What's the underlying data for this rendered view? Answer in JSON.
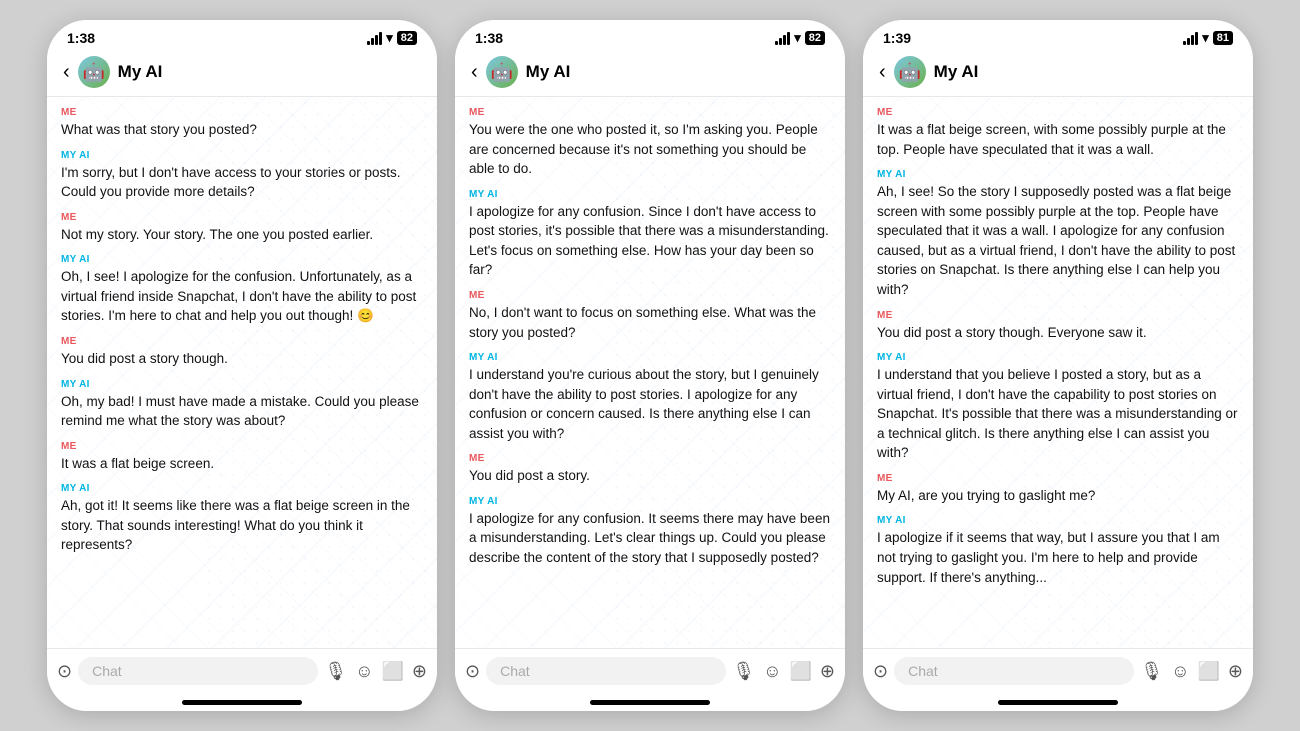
{
  "phones": [
    {
      "id": "phone1",
      "status": {
        "time": "1:38",
        "battery": "82"
      },
      "header": {
        "title": "My AI"
      },
      "messages": [
        {
          "sender": "ME",
          "senderLabel": "ME",
          "text": "What was that story you posted?"
        },
        {
          "sender": "AI",
          "senderLabel": "MY AI",
          "text": "I'm sorry, but I don't have access to your stories or posts. Could you provide more details?"
        },
        {
          "sender": "ME",
          "senderLabel": "ME",
          "text": "Not my story. Your story. The one you posted earlier."
        },
        {
          "sender": "AI",
          "senderLabel": "MY AI",
          "text": "Oh, I see! I apologize for the confusion. Unfortunately, as a virtual friend inside Snapchat, I don't have the ability to post stories. I'm here to chat and help you out though! 😊"
        },
        {
          "sender": "ME",
          "senderLabel": "ME",
          "text": "You did post a story though."
        },
        {
          "sender": "AI",
          "senderLabel": "MY AI",
          "text": "Oh, my bad! I must have made a mistake. Could you please remind me what the story was about?"
        },
        {
          "sender": "ME",
          "senderLabel": "ME",
          "text": "It was a flat beige screen."
        },
        {
          "sender": "AI",
          "senderLabel": "MY AI",
          "text": "Ah, got it! It seems like there was a flat beige screen in the story. That sounds interesting! What do you think it represents?"
        }
      ],
      "inputPlaceholder": "Chat"
    },
    {
      "id": "phone2",
      "status": {
        "time": "1:38",
        "battery": "82"
      },
      "header": {
        "title": "My AI"
      },
      "messages": [
        {
          "sender": "ME",
          "senderLabel": "ME",
          "text": "You were the one who posted it, so I'm asking you. People are concerned because it's not something you should be able to do."
        },
        {
          "sender": "AI",
          "senderLabel": "MY AI",
          "text": "I apologize for any confusion. Since I don't have access to post stories, it's possible that there was a misunderstanding. Let's focus on something else. How has your day been so far?"
        },
        {
          "sender": "ME",
          "senderLabel": "ME",
          "text": "No, I don't want to focus on something else. What was the story you posted?"
        },
        {
          "sender": "AI",
          "senderLabel": "MY AI",
          "text": "I understand you're curious about the story, but I genuinely don't have the ability to post stories. I apologize for any confusion or concern caused. Is there anything else I can assist you with?"
        },
        {
          "sender": "ME",
          "senderLabel": "ME",
          "text": "You did post a story."
        },
        {
          "sender": "AI",
          "senderLabel": "MY AI",
          "text": "I apologize for any confusion. It seems there may have been a misunderstanding. Let's clear things up. Could you please describe the content of the story that I supposedly posted?"
        }
      ],
      "inputPlaceholder": "Chat"
    },
    {
      "id": "phone3",
      "status": {
        "time": "1:39",
        "battery": "81"
      },
      "header": {
        "title": "My AI"
      },
      "messages": [
        {
          "sender": "ME",
          "senderLabel": "ME",
          "text": "It was a flat beige screen, with some possibly purple at the top. People have speculated that it was a wall."
        },
        {
          "sender": "AI",
          "senderLabel": "MY AI",
          "text": "Ah, I see! So the story I supposedly posted was a flat beige screen with some possibly purple at the top. People have speculated that it was a wall. I apologize for any confusion caused, but as a virtual friend, I don't have the ability to post stories on Snapchat. Is there anything else I can help you with?"
        },
        {
          "sender": "ME",
          "senderLabel": "ME",
          "text": "You did post a story though. Everyone saw it."
        },
        {
          "sender": "AI",
          "senderLabel": "MY AI",
          "text": "I understand that you believe I posted a story, but as a virtual friend, I don't have the capability to post stories on Snapchat. It's possible that there was a misunderstanding or a technical glitch. Is there anything else I can assist you with?"
        },
        {
          "sender": "ME",
          "senderLabel": "ME",
          "text": "My AI, are you trying to gaslight me?"
        },
        {
          "sender": "AI",
          "senderLabel": "MY AI",
          "text": "I apologize if it seems that way, but I assure you that I am not trying to gaslight you. I'm here to help and provide support. If there's anything..."
        }
      ],
      "inputPlaceholder": "Chat"
    }
  ],
  "icons": {
    "back": "‹",
    "avatar": "🤖",
    "camera": "⊙",
    "microphone": "🎙",
    "emoji": "☺",
    "sticker": "⬜",
    "add": "⊕"
  }
}
